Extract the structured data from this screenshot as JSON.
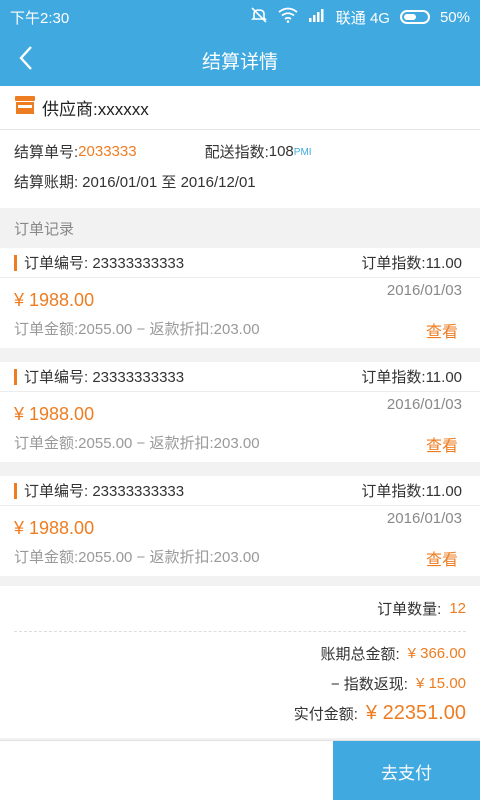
{
  "status": {
    "time": "下午2:30",
    "carrier": "联通 4G",
    "battery": "50%"
  },
  "nav": {
    "title": "结算详情"
  },
  "supplier": {
    "name": "供应商:xxxxxx",
    "settle_no_label": "结算单号:",
    "settle_no": "2033333",
    "delivery_index_label": "配送指数:",
    "delivery_index": "108",
    "delivery_index_unit": "PMI",
    "period_label": "结算账期:",
    "period": "2016/01/01 至 2016/12/01"
  },
  "records_title": "订单记录",
  "orders": [
    {
      "order_no": "订单编号: 23333333333",
      "index": "订单指数:11.00",
      "price": "¥ 1988.00",
      "date": "2016/01/03",
      "detail": "订单金额:2055.00 − 返款折扣:203.00",
      "view": "查看"
    },
    {
      "order_no": "订单编号: 23333333333",
      "index": "订单指数:11.00",
      "price": "¥ 1988.00",
      "date": "2016/01/03",
      "detail": "订单金额:2055.00 − 返款折扣:203.00",
      "view": "查看"
    },
    {
      "order_no": "订单编号: 23333333333",
      "index": "订单指数:11.00",
      "price": "¥ 1988.00",
      "date": "2016/01/03",
      "detail": "订单金额:2055.00 − 返款折扣:203.00",
      "view": "查看"
    }
  ],
  "summary": {
    "count_label": "订单数量:",
    "count": "12",
    "total_label": "账期总金额:",
    "total": "¥ 366.00",
    "rebate_label": "− 指数返现:",
    "rebate": "¥ 15.00",
    "paid_label": "实付金额:",
    "paid": "¥ 22351.00"
  },
  "pay_button": "去支付",
  "colors": {
    "primary": "#3fa9e0",
    "accent": "#ee7d22"
  }
}
